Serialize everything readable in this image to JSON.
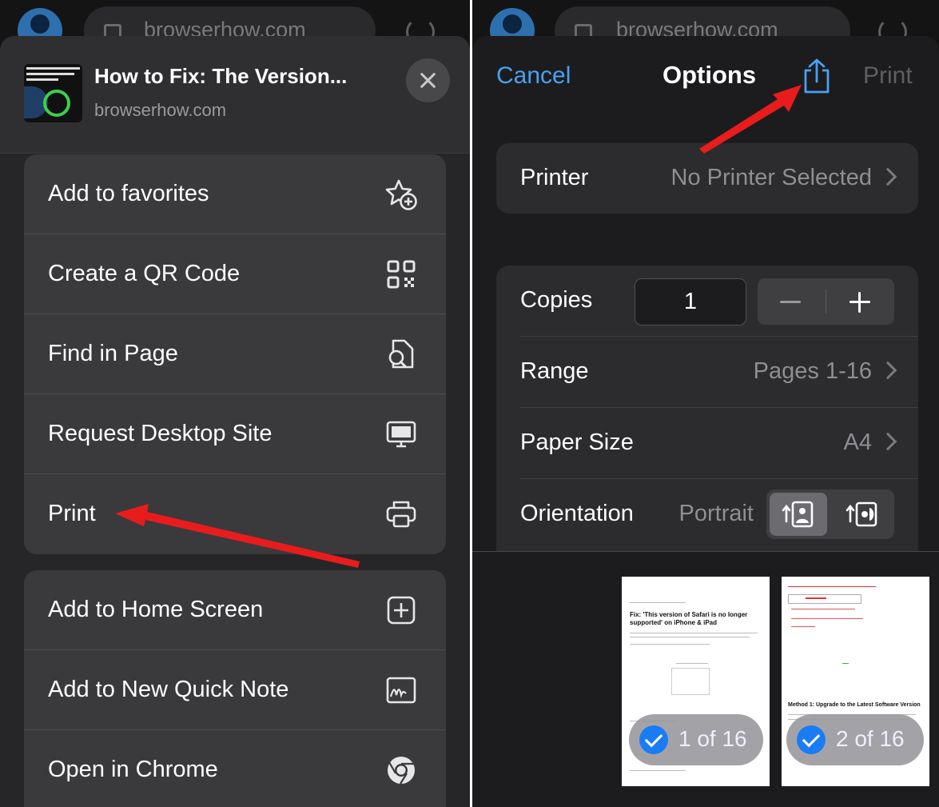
{
  "left": {
    "browser": {
      "domain": "browserhow.com"
    },
    "header": {
      "title": "How to Fix: The Version...",
      "domain": "browserhow.com"
    },
    "menu_group_1": [
      {
        "label": "Add to favorites",
        "icon": "star-plus-icon"
      },
      {
        "label": "Create a QR Code",
        "icon": "qr-code-icon"
      },
      {
        "label": "Find in Page",
        "icon": "doc-search-icon"
      },
      {
        "label": "Request Desktop Site",
        "icon": "desktop-icon"
      },
      {
        "label": "Print",
        "icon": "printer-icon"
      }
    ],
    "menu_group_2": [
      {
        "label": "Add to Home Screen",
        "icon": "plus-square-icon"
      },
      {
        "label": "Add to New Quick Note",
        "icon": "quick-note-icon"
      },
      {
        "label": "Open in Chrome",
        "icon": "chrome-icon"
      }
    ]
  },
  "right": {
    "browser": {
      "domain": "browserhow.com"
    },
    "nav": {
      "cancel": "Cancel",
      "title": "Options",
      "print": "Print"
    },
    "printer": {
      "label": "Printer",
      "value": "No Printer Selected"
    },
    "copies": {
      "label": "Copies",
      "value": "1"
    },
    "range": {
      "label": "Range",
      "value": "Pages 1-16"
    },
    "paper_size": {
      "label": "Paper Size",
      "value": "A4"
    },
    "orientation": {
      "label": "Orientation",
      "value": "Portrait"
    },
    "pages": [
      {
        "badge": "1 of 16",
        "heading": "Fix: 'This version of Safari is no longer supported' on iPhone & iPad"
      },
      {
        "badge": "2 of 16",
        "heading": "Method 1: Upgrade to the Latest Software Version"
      }
    ]
  },
  "colors": {
    "accent": "#4aa0f0",
    "annotation_arrow": "#e81c1c",
    "checkmark": "#1a7cf5"
  }
}
